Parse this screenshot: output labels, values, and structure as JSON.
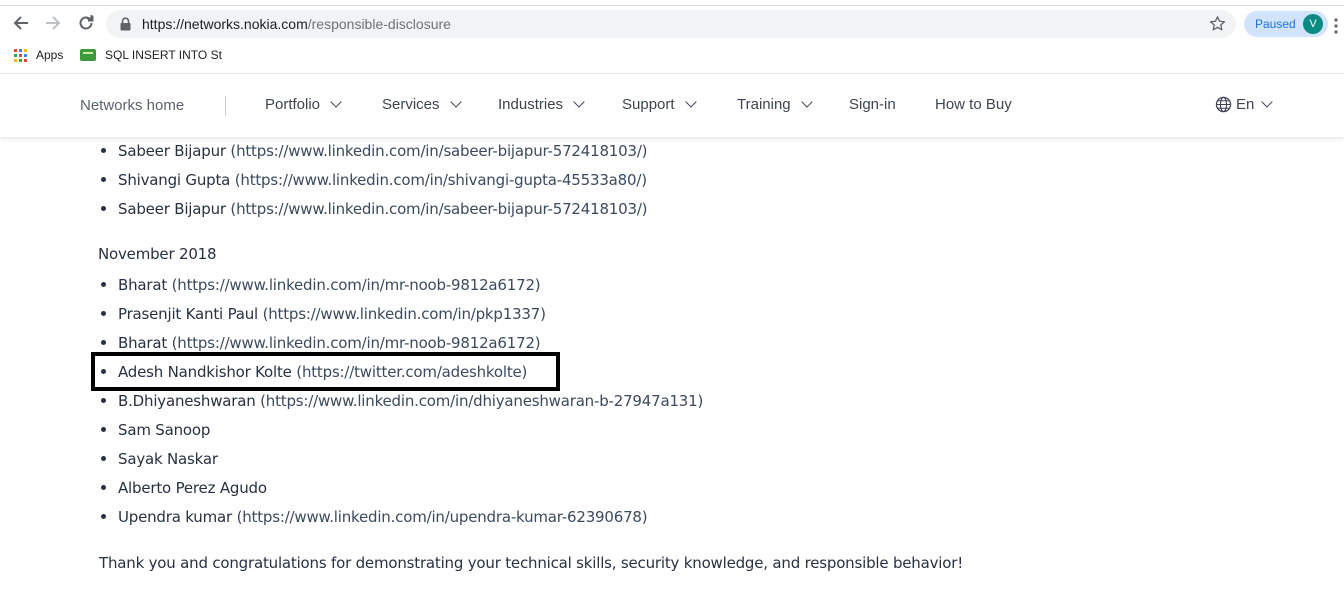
{
  "browser": {
    "url_host": "https://networks.nokia.com",
    "url_path": "/responsible-disclosure",
    "profile_status": "Paused",
    "profile_initial": "V",
    "bookmarks": [
      {
        "label": "Apps",
        "icon": "apps-grid-icon"
      },
      {
        "label": "SQL INSERT INTO St",
        "icon": "sql-favicon"
      }
    ],
    "icons": {
      "back": "arrow-left-icon",
      "forward": "arrow-right-icon",
      "reload": "reload-icon",
      "secure": "lock-icon",
      "bookmark": "star-icon",
      "menu": "more-vertical-icon"
    }
  },
  "site_nav": {
    "home": "Networks home",
    "items": [
      {
        "label": "Portfolio",
        "has_menu": true
      },
      {
        "label": "Services",
        "has_menu": true
      },
      {
        "label": "Industries",
        "has_menu": true
      },
      {
        "label": "Support",
        "has_menu": true
      },
      {
        "label": "Training",
        "has_menu": true
      },
      {
        "label": "Sign-in",
        "has_menu": false
      },
      {
        "label": "How to Buy",
        "has_menu": false
      }
    ],
    "language": "En"
  },
  "content": {
    "top_list": [
      {
        "name": "Sabeer Bijapur",
        "link": "(https://www.linkedin.com/in/sabeer-bijapur-572418103/)"
      },
      {
        "name": "Shivangi Gupta",
        "link": "(https://www.linkedin.com/in/shivangi-gupta-45533a80/)"
      },
      {
        "name": "Sabeer Bijapur",
        "link": "(https://www.linkedin.com/in/sabeer-bijapur-572418103/)"
      }
    ],
    "section_heading": "November 2018",
    "november_list": [
      {
        "name": "Bharat",
        "link": "(https://www.linkedin.com/in/mr-noob-9812a6172)"
      },
      {
        "name": "Prasenjit Kanti Paul",
        "link": "(https://www.linkedin.com/in/pkp1337)"
      },
      {
        "name": "Bharat",
        "link": "(https://www.linkedin.com/in/mr-noob-9812a6172)"
      },
      {
        "name": "Adesh Nandkishor Kolte",
        "link": "(https://twitter.com/adeshkolte)"
      },
      {
        "name": "B.Dhiyaneshwaran",
        "link": "(https://www.linkedin.com/in/dhiyaneshwaran-b-27947a131)"
      },
      {
        "name": "Sam Sanoop",
        "link": ""
      },
      {
        "name": "Sayak Naskar",
        "link": ""
      },
      {
        "name": "Alberto Perez Agudo",
        "link": ""
      },
      {
        "name": "Upendra kumar",
        "link": "(https://www.linkedin.com/in/upendra-kumar-62390678)"
      }
    ],
    "thanks": "Thank you and congratulations for demonstrating your technical skills, security knowledge, and responsible behavior!"
  },
  "colors": {
    "highlight_box": "#000000",
    "profile_chip": "#d2e3fc",
    "avatar": "#0b8a84"
  }
}
